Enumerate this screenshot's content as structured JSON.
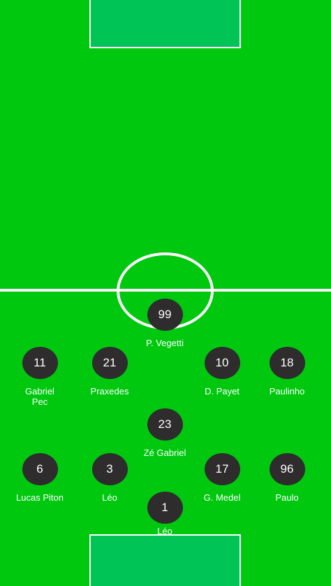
{
  "pitch": {
    "colors": {
      "grass": "#00C80F",
      "penalty_box": "#00C455",
      "lines": "#FFFFFF",
      "token": "#2E2C2C"
    }
  },
  "players": [
    {
      "number": "99",
      "name": "P. Vegetti"
    },
    {
      "number": "11",
      "name": "Gabriel Pec"
    },
    {
      "number": "21",
      "name": "Praxedes"
    },
    {
      "number": "10",
      "name": "D. Payet"
    },
    {
      "number": "18",
      "name": "Paulinho"
    },
    {
      "number": "23",
      "name": "Zé Gabriel"
    },
    {
      "number": "6",
      "name": "Lucas Piton"
    },
    {
      "number": "3",
      "name": "Léo"
    },
    {
      "number": "17",
      "name": "G. Medel"
    },
    {
      "number": "96",
      "name": "Paulo"
    },
    {
      "number": "1",
      "name": "Léo"
    }
  ]
}
